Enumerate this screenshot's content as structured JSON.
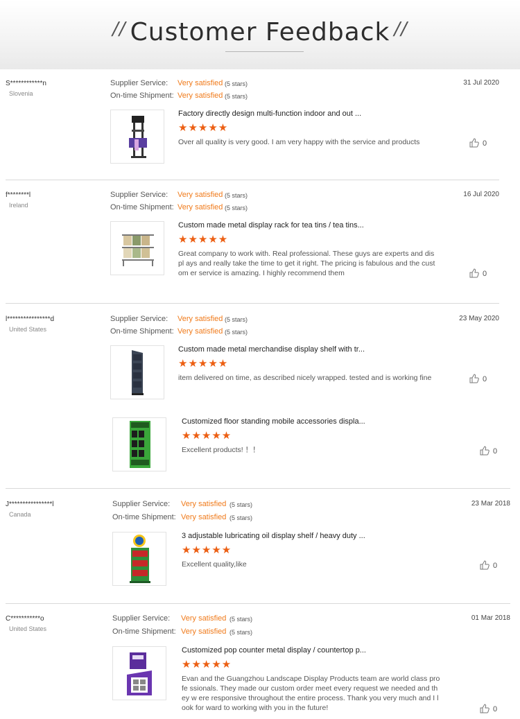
{
  "header": {
    "title": "Customer Feedback",
    "slash": "//"
  },
  "rating_labels": {
    "supplier": "Supplier Service:",
    "shipment": "On-time Shipment:"
  },
  "reviews": [
    {
      "user": "S************n",
      "country": "Slovenia",
      "date": "31 Jul 2020",
      "supplier_value": "Very satisfied",
      "supplier_stars": "(5 stars)",
      "shipment_value": "Very satisfied",
      "shipment_stars": "(5 stars)",
      "items": [
        {
          "title": "Factory directly design multi-function indoor and out ...",
          "stars": "★★★★★",
          "comment": "Over all quality is very good. I am very happy with the service and products",
          "likes": "0"
        }
      ]
    },
    {
      "user": "f********l",
      "country": "Ireland",
      "date": "16 Jul 2020",
      "supplier_value": "Very satisfied",
      "supplier_stars": "(5 stars)",
      "shipment_value": "Very satisfied",
      "shipment_stars": "(5 stars)",
      "items": [
        {
          "title": "Custom made metal display rack for tea tins / tea tins...",
          "stars": "★★★★★",
          "comment": "Great company to work with. Real professional. These guys are experts and displ ays and really take the time to get it right. The pricing is fabulous and the custom er service is amazing. I highly recommend them",
          "likes": "0"
        }
      ]
    },
    {
      "user": "l****************d",
      "country": "United States",
      "date": "23 May 2020",
      "supplier_value": "Very satisfied",
      "supplier_stars": "(5 stars)",
      "shipment_value": "Very satisfied",
      "shipment_stars": "(5 stars)",
      "items": [
        {
          "title": "Custom made metal merchandise display shelf with tr...",
          "stars": "★★★★★",
          "comment": "item delivered on time, as described nicely wrapped. tested and is working fine",
          "likes": "0"
        },
        {
          "title": "Customized floor standing mobile accessories displa...",
          "stars": "★★★★★",
          "comment": "Excellent products! ！！",
          "likes": "0"
        }
      ]
    },
    {
      "user": "J****************l",
      "country": "Canada",
      "date": "23 Mar 2018",
      "supplier_value": "Very satisfied",
      "supplier_stars": "(5 stars)",
      "shipment_value": "Very satisfied",
      "shipment_stars": "(5 stars)",
      "items": [
        {
          "title": "3 adjustable lubricating oil display shelf / heavy duty ...",
          "stars": "★★★★★",
          "comment": "Excellent quality,like",
          "likes": "0"
        }
      ]
    },
    {
      "user": "C***********o",
      "country": "United States",
      "date": "01 Mar 2018",
      "supplier_value": "Very satisfied",
      "supplier_stars": "(5 stars)",
      "shipment_value": "Very satisfied",
      "shipment_stars": "(5 stars)",
      "items": [
        {
          "title": "Customized pop counter metal display / countertop p...",
          "stars": "★★★★★",
          "comment": "Evan and the Guangzhou Landscape Display Products team are world class profe ssionals. They made our custom order meet every request we needed and they w ere responsive throughout the entire process. Thank you very much and I look for ward to working with you in the future!",
          "likes": "0"
        }
      ]
    }
  ],
  "colors": {
    "accent_orange": "#f07a1a",
    "star": "#ec5f13",
    "separator": "#d9d9d9"
  },
  "icons": {
    "like": "thumbs-up-icon"
  }
}
